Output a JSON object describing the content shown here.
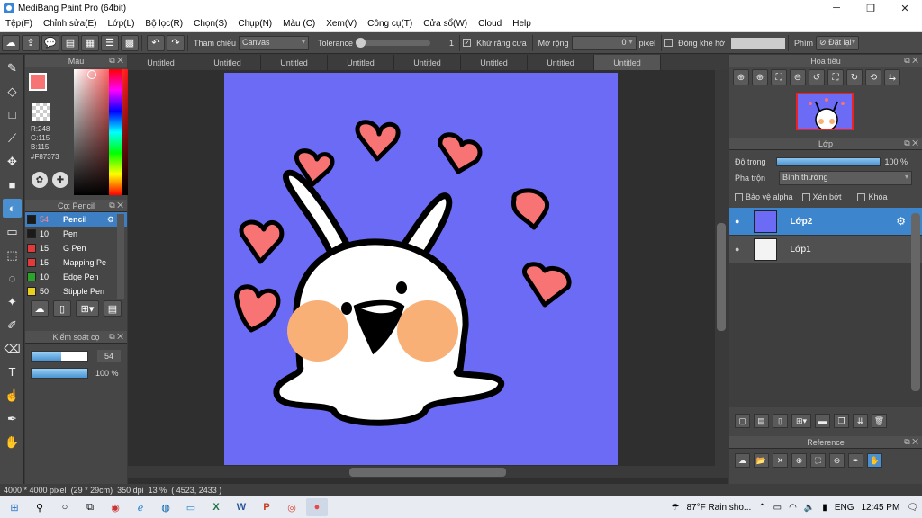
{
  "window": {
    "title": "MediBang Paint Pro (64bit)",
    "controls": [
      "─",
      "❐",
      "✕"
    ]
  },
  "menu": [
    "Tệp(F)",
    "Chỉnh sửa(E)",
    "Lớp(L)",
    "Bộ lọc(R)",
    "Chọn(S)",
    "Chụp(N)",
    "Màu (C)",
    "Xem(V)",
    "Công cụ(T)",
    "Cửa sổ(W)",
    "Cloud",
    "Help"
  ],
  "toolbar": {
    "reference_label": "Tham chiếu",
    "reference_value": "Canvas",
    "tolerance_label": "Tolerance",
    "tolerance_value": "1",
    "tolerance_level": 0.01,
    "antialias_label": "Khử răng cưa",
    "antialias_checked": "✓",
    "expand_label": "Mở rộng",
    "expand_value": "0",
    "expand_unit": "pixel",
    "close_gap_label": "Đóng khe hở",
    "shortcut_label": "Phím",
    "reset_label": "Đặt lại"
  },
  "color_panel": {
    "title": "Màu",
    "fg_color": "#F87373",
    "r": "R:248",
    "g": "G:115",
    "b": "B:115",
    "hex": "#F87373"
  },
  "brush_panel": {
    "title": "Cọ: Pencil",
    "brushes": [
      {
        "size": "54",
        "name": "Pencil",
        "color": "#1a1a1a"
      },
      {
        "size": "10",
        "name": "Pen",
        "color": "#1a1a1a"
      },
      {
        "size": "15",
        "name": "G Pen",
        "color": "#e03a3a"
      },
      {
        "size": "15",
        "name": "Mapping Pe",
        "color": "#e03a3a"
      },
      {
        "size": "10",
        "name": "Edge Pen",
        "color": "#2aa52a"
      },
      {
        "size": "50",
        "name": "Stipple Pen",
        "color": "#e8d020"
      }
    ]
  },
  "brush_control": {
    "title": "Kiểm soát cọ",
    "size_value": "54",
    "opacity_value": "100 %",
    "size_level": 0.54,
    "opacity_level": 1.0
  },
  "tabs": [
    "Untitled",
    "Untitled",
    "Untitled",
    "Untitled",
    "Untitled",
    "Untitled",
    "Untitled",
    "Untitled"
  ],
  "canvas_bg": "#6B6BF6",
  "navigator": {
    "title": "Hoa tiêu"
  },
  "layer_panel": {
    "title": "Lớp",
    "opacity_label": "Độ trong",
    "opacity_value": "100 %",
    "blend_label": "Pha trộn",
    "blend_value": "Bình thường",
    "protect_alpha": "Bảo vệ alpha",
    "clip": "Xén bớt",
    "lock": "Khóa",
    "layers": [
      "Lớp2",
      "Lớp1"
    ]
  },
  "reference_panel": {
    "title": "Reference"
  },
  "status": {
    "size": "4000 * 4000 pixel",
    "cm": "(29 * 29cm)",
    "dpi": "350 dpi",
    "zoom": "13 %",
    "coords": "( 4523, 2433 )"
  },
  "taskbar": {
    "weather": "87°F  Rain sho...",
    "lang": "ENG",
    "time": "12:45 PM"
  }
}
